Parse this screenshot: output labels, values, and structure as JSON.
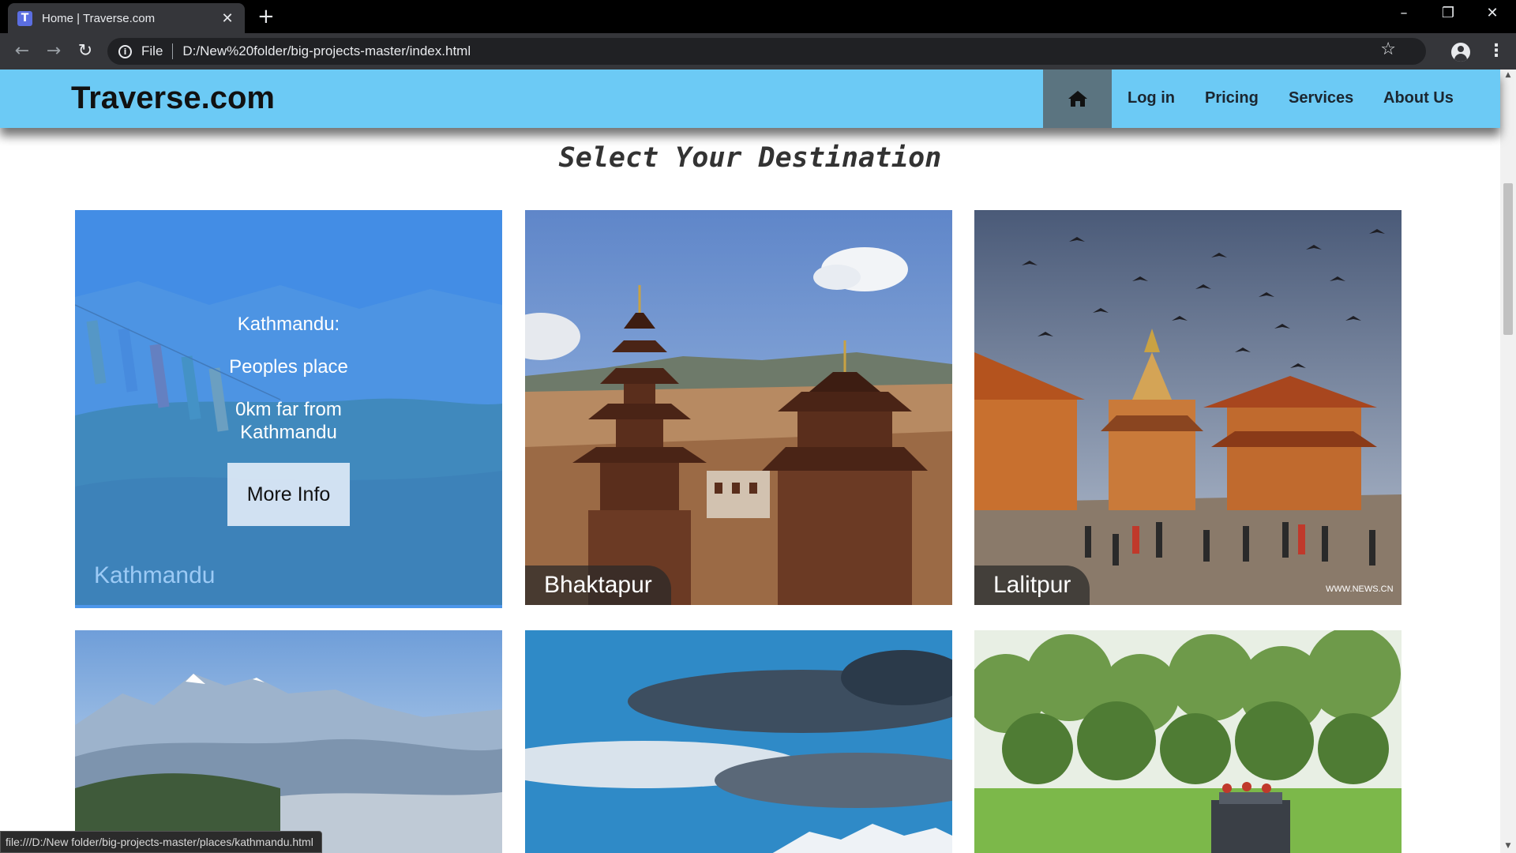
{
  "browser": {
    "tab_title": "Home | Traverse.com",
    "favicon_letter": "T",
    "address_scheme": "File",
    "address_url": "D:/New%20folder/big-projects-master/index.html",
    "status_url": "file:///D:/New folder/big-projects-master/places/kathmandu.html"
  },
  "site": {
    "brand": "Traverse.com",
    "nav": {
      "login": "Log in",
      "pricing": "Pricing",
      "services": "Services",
      "about": "About Us"
    },
    "heading": "Select Your Destination"
  },
  "destinations": [
    {
      "name": "Kathmandu",
      "hover_title": "Kathmandu:",
      "hover_tagline": "Peoples place",
      "hover_distance": "0km far from Kathmandu",
      "button": "More Info"
    },
    {
      "name": "Bhaktapur"
    },
    {
      "name": "Lalitpur"
    }
  ],
  "colors": {
    "navbar": "#6ccaf5",
    "home_active": "#5b7480",
    "overlay": "#4696f0"
  },
  "icons": [
    "home-icon",
    "back-arrow-icon",
    "forward-arrow-icon",
    "reload-icon",
    "info-icon",
    "star-icon",
    "profile-icon",
    "menu-icon"
  ]
}
